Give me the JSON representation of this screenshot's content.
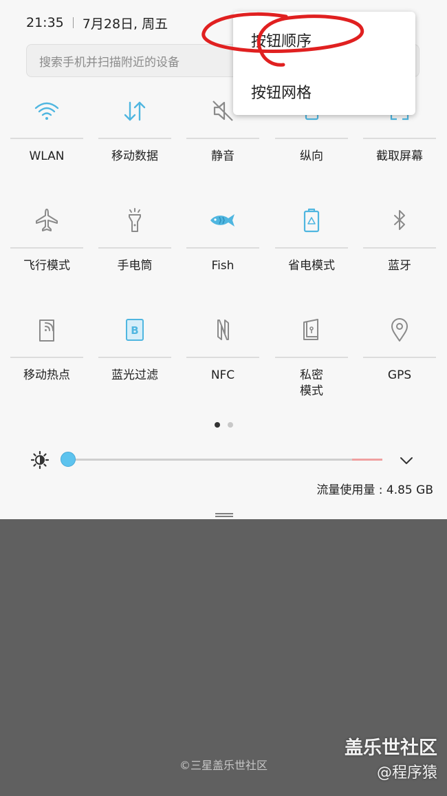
{
  "status_bar": {
    "time": "21:35",
    "date": "7月28日, 周五"
  },
  "search": {
    "placeholder": "搜索手机并扫描附近的设备"
  },
  "tiles": [
    {
      "label": "WLAN",
      "icon": "wifi-icon",
      "active": true
    },
    {
      "label": "移动数据",
      "icon": "mobile-data-icon",
      "active": true
    },
    {
      "label": "静音",
      "icon": "mute-icon",
      "active": false
    },
    {
      "label": "纵向",
      "icon": "portrait-icon",
      "active": true
    },
    {
      "label": "截取屏幕",
      "icon": "screenshot-icon",
      "active": true
    },
    {
      "label": "飞行模式",
      "icon": "airplane-icon",
      "active": false
    },
    {
      "label": "手电筒",
      "icon": "flashlight-icon",
      "active": false
    },
    {
      "label": "Fish",
      "icon": "fish-icon",
      "active": true
    },
    {
      "label": "省电模式",
      "icon": "battery-saver-icon",
      "active": true
    },
    {
      "label": "蓝牙",
      "icon": "bluetooth-icon",
      "active": false
    },
    {
      "label": "移动热点",
      "icon": "hotspot-icon",
      "active": false
    },
    {
      "label": "蓝光过滤",
      "icon": "blue-light-filter-icon",
      "active": true
    },
    {
      "label": "NFC",
      "icon": "nfc-icon",
      "active": false
    },
    {
      "label": "私密\n模式",
      "icon": "private-mode-icon",
      "active": false
    },
    {
      "label": "GPS",
      "icon": "gps-icon",
      "active": false
    }
  ],
  "page_indicator": {
    "pages": 2,
    "current": 1
  },
  "brightness": {
    "level": 0.0
  },
  "data_usage": "流量使用量 : 4.85 GB",
  "menu": {
    "items": [
      "按钮顺序",
      "按钮网格"
    ]
  },
  "footer": {
    "copyright": "©三星盖乐世社区"
  },
  "watermark": {
    "line1": "盖乐世社区",
    "line2": "@程序猿"
  },
  "colors": {
    "accent": "#4fb6e0",
    "panel": "#f7f7f7",
    "overlay": "#606060",
    "annotation": "#e02020"
  }
}
